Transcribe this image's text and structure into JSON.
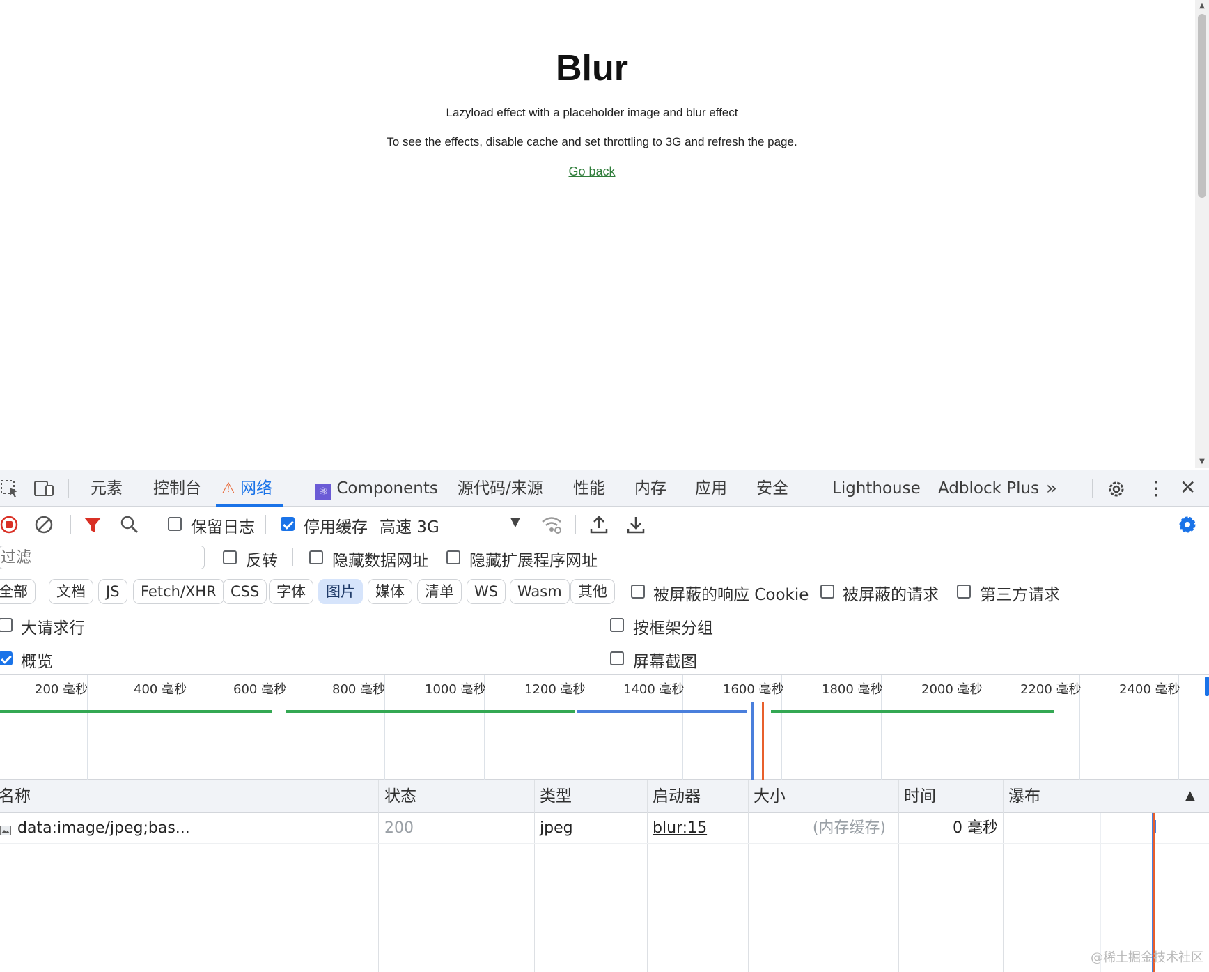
{
  "page": {
    "title": "Blur",
    "line1": "Lazyload effect with a placeholder image and blur effect",
    "line2": "To see the effects, disable cache and set throttling to 3G and refresh the page.",
    "back_link": "Go back"
  },
  "devtools": {
    "tabs": [
      "元素",
      "控制台",
      "网络",
      "Components",
      "源代码/来源",
      "性能",
      "内存",
      "应用",
      "安全",
      "Lighthouse",
      "Adblock Plus"
    ],
    "active_tab": "网络",
    "toolbar": {
      "preserve_log": "保留日志",
      "preserve_log_checked": false,
      "disable_cache": "停用缓存",
      "disable_cache_checked": true,
      "throttling": "高速 3G"
    },
    "filter": {
      "placeholder": "过滤",
      "invert": "反转",
      "hide_data_urls": "隐藏数据网址",
      "hide_extension_urls": "隐藏扩展程序网址"
    },
    "type_filters": [
      "全部",
      "文档",
      "JS",
      "Fetch/XHR",
      "CSS",
      "字体",
      "图片",
      "媒体",
      "清单",
      "WS",
      "Wasm",
      "其他"
    ],
    "selected_type": "图片",
    "extra_filters": [
      "被屏蔽的响应 Cookie",
      "被屏蔽的请求",
      "第三方请求"
    ],
    "options": {
      "big_rows": "大请求行",
      "group_by_frame": "按框架分组",
      "overview": "概览",
      "overview_checked": true,
      "screenshots": "屏幕截图"
    },
    "timeline_ticks": [
      "200 毫秒",
      "400 毫秒",
      "600 毫秒",
      "800 毫秒",
      "1000 毫秒",
      "1200 毫秒",
      "1400 毫秒",
      "1600 毫秒",
      "1800 毫秒",
      "2000 毫秒",
      "2200 毫秒",
      "2400 毫秒"
    ],
    "columns": [
      "名称",
      "状态",
      "类型",
      "启动器",
      "大小",
      "时间",
      "瀑布"
    ],
    "rows": [
      {
        "name": "data:image/jpeg;bas...",
        "status": "200",
        "type": "jpeg",
        "initiator": "blur:15",
        "size": "(内存缓存)",
        "time": "0 毫秒"
      }
    ]
  },
  "colors": {
    "accent": "#1a73e8",
    "link": "#2f7d3a",
    "record": "#d93025",
    "bar_green": "#34a853",
    "bar_blue": "#4a7fdc",
    "marker_red": "#e8602c"
  },
  "watermark": "@稀土掘金技术社区"
}
